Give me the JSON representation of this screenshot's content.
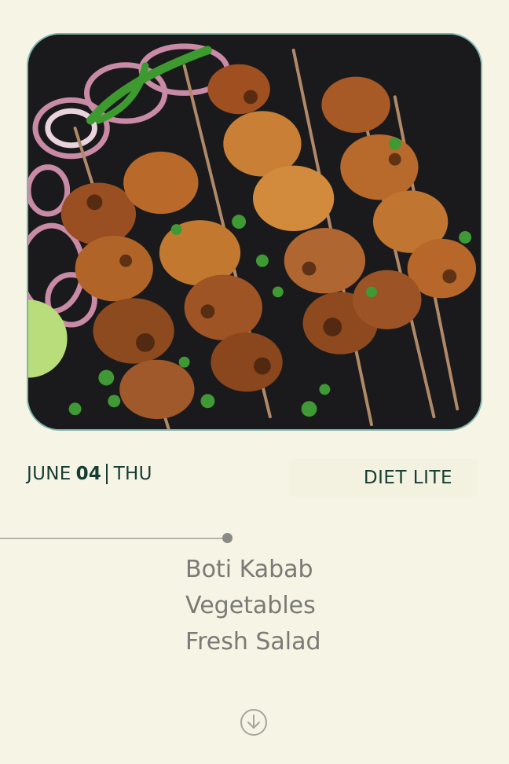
{
  "meal_card": {
    "photo_alt": "Boti Kabab",
    "date": {
      "month": "JUNE",
      "day": "04",
      "weekday": "THU"
    },
    "plan_label": "DIET LITE",
    "menu_items": [
      "Boti Kabab",
      "Vegetables",
      "Fresh Salad"
    ],
    "scroll_icon": "arrow-down-circle-icon"
  },
  "colors": {
    "background": "#f6f4e4",
    "text_dark": "#163d33",
    "menu_text": "#7a7a76",
    "card_border": "#7fb3ad"
  }
}
